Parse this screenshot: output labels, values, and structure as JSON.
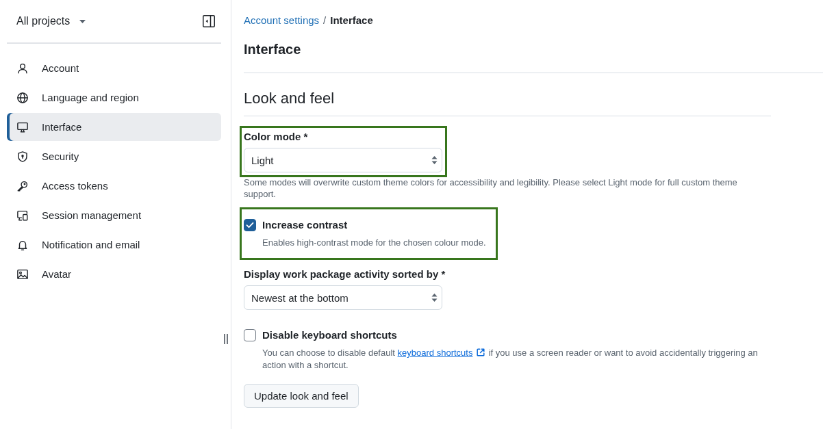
{
  "sidebar": {
    "project_selector": {
      "label": "All projects"
    },
    "items": [
      {
        "label": "Account",
        "selected": false
      },
      {
        "label": "Language and region",
        "selected": false
      },
      {
        "label": "Interface",
        "selected": true
      },
      {
        "label": "Security",
        "selected": false
      },
      {
        "label": "Access tokens",
        "selected": false
      },
      {
        "label": "Session management",
        "selected": false
      },
      {
        "label": "Notification and email",
        "selected": false
      },
      {
        "label": "Avatar",
        "selected": false
      }
    ]
  },
  "breadcrumb": {
    "items": [
      {
        "label": "Account settings",
        "current": false
      },
      {
        "label": "Interface",
        "current": true
      }
    ],
    "separator": "/"
  },
  "page_title": "Interface",
  "section_title": "Look and feel",
  "form": {
    "fields": [
      {
        "kind": "select",
        "label": "Color mode *",
        "value": "Light",
        "help": "Some modes will overwrite custom theme colors for accessibility and legibility. Please select Light mode for full custom theme support.",
        "highlighted": true
      },
      {
        "kind": "checkbox",
        "label": "Increase contrast",
        "checked": true,
        "description": "Enables high-contrast mode for the chosen colour mode.",
        "highlighted": true
      },
      {
        "kind": "select",
        "label": "Display work package activity sorted by *",
        "value": "Newest at the bottom",
        "highlighted": false
      },
      {
        "kind": "checkbox",
        "label": "Disable keyboard shortcuts",
        "checked": false,
        "description": "You can choose to disable default",
        "description_link": "keyboard shortcuts",
        "description_after": "if you use a screen reader or want to avoid accidentally triggering an action with a shortcut.",
        "highlighted": false
      }
    ],
    "submit": {
      "label": "Update look and feel"
    }
  }
}
